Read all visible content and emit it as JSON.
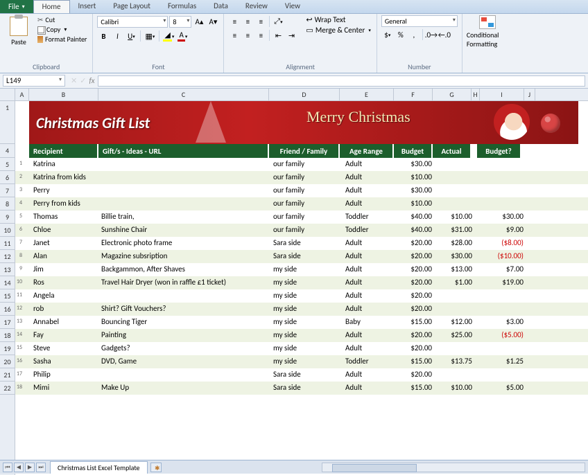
{
  "ribbon": {
    "file": "File",
    "tabs": [
      "Home",
      "Insert",
      "Page Layout",
      "Formulas",
      "Data",
      "Review",
      "View"
    ],
    "active_tab": "Home",
    "clipboard": {
      "title": "Clipboard",
      "paste": "Paste",
      "cut": "Cut",
      "copy": "Copy",
      "format_painter": "Format Painter"
    },
    "font": {
      "title": "Font",
      "name": "Calibri",
      "size": "8"
    },
    "alignment": {
      "title": "Alignment",
      "wrap": "Wrap Text",
      "merge": "Merge & Center"
    },
    "number": {
      "title": "Number",
      "format": "General"
    },
    "cf": "Conditional Formatting"
  },
  "formula_bar": {
    "name_box": "L149",
    "fx": "fx",
    "value": ""
  },
  "columns": [
    "A",
    "B",
    "C",
    "D",
    "E",
    "F",
    "G",
    "H",
    "I",
    "J"
  ],
  "row_headers": [
    "1",
    "4",
    "5",
    "6",
    "7",
    "8",
    "9",
    "10",
    "11",
    "12",
    "13",
    "14",
    "15",
    "16",
    "17",
    "18",
    "19",
    "20",
    "21",
    "22"
  ],
  "banner": {
    "title": "Christmas Gift List",
    "merry": "Merry Christmas"
  },
  "table": {
    "headers": {
      "recipient": "Recipient",
      "gift": "Gift/s - Ideas - URL",
      "ff": "Friend / Family",
      "age": "Age Range",
      "budget": "Budget",
      "actual": "Actual",
      "budget_q": "Budget?"
    },
    "rows": [
      {
        "n": "1",
        "recipient": "Katrina",
        "gift": "",
        "ff": "our family",
        "age": "Adult",
        "budget": "$30.00",
        "actual": "",
        "q": ""
      },
      {
        "n": "2",
        "recipient": "Katrina from kids",
        "gift": "",
        "ff": "our family",
        "age": "Adult",
        "budget": "$10.00",
        "actual": "",
        "q": ""
      },
      {
        "n": "3",
        "recipient": "Perry",
        "gift": "",
        "ff": "our family",
        "age": "Adult",
        "budget": "$30.00",
        "actual": "",
        "q": ""
      },
      {
        "n": "4",
        "recipient": "Perry from kids",
        "gift": "",
        "ff": "our family",
        "age": "Adult",
        "budget": "$10.00",
        "actual": "",
        "q": ""
      },
      {
        "n": "5",
        "recipient": "Thomas",
        "gift": "Billie train,",
        "ff": "our family",
        "age": "Toddler",
        "budget": "$40.00",
        "actual": "$10.00",
        "q": "$30.00"
      },
      {
        "n": "6",
        "recipient": "Chloe",
        "gift": "Sunshine Chair",
        "ff": "our family",
        "age": "Toddler",
        "budget": "$40.00",
        "actual": "$31.00",
        "q": "$9.00"
      },
      {
        "n": "7",
        "recipient": "Janet",
        "gift": "Electronic photo frame",
        "ff": "Sara side",
        "age": "Adult",
        "budget": "$20.00",
        "actual": "$28.00",
        "q": "($8.00)",
        "neg": true
      },
      {
        "n": "8",
        "recipient": "Alan",
        "gift": "Magazine subsription",
        "ff": "Sara side",
        "age": "Adult",
        "budget": "$20.00",
        "actual": "$30.00",
        "q": "($10.00)",
        "neg": true
      },
      {
        "n": "9",
        "recipient": "Jim",
        "gift": "Backgammon, After Shaves",
        "ff": "my side",
        "age": "Adult",
        "budget": "$20.00",
        "actual": "$13.00",
        "q": "$7.00"
      },
      {
        "n": "10",
        "recipient": "Ros",
        "gift": "Travel Hair Dryer (won in raffle £1 ticket)",
        "ff": "my side",
        "age": "Adult",
        "budget": "$20.00",
        "actual": "$1.00",
        "q": "$19.00"
      },
      {
        "n": "11",
        "recipient": "Angela",
        "gift": "",
        "ff": "my side",
        "age": "Adult",
        "budget": "$20.00",
        "actual": "",
        "q": ""
      },
      {
        "n": "12",
        "recipient": "rob",
        "gift": "Shirt? Gift Vouchers?",
        "ff": "my side",
        "age": "Adult",
        "budget": "$20.00",
        "actual": "",
        "q": ""
      },
      {
        "n": "13",
        "recipient": "Annabel",
        "gift": "Bouncing Tiger",
        "ff": "my side",
        "age": "Baby",
        "budget": "$15.00",
        "actual": "$12.00",
        "q": "$3.00"
      },
      {
        "n": "14",
        "recipient": "Fay",
        "gift": "Painting",
        "ff": "my side",
        "age": "Adult",
        "budget": "$20.00",
        "actual": "$25.00",
        "q": "($5.00)",
        "neg": true
      },
      {
        "n": "15",
        "recipient": "Steve",
        "gift": "Gadgets?",
        "ff": "my side",
        "age": "Adult",
        "budget": "$20.00",
        "actual": "",
        "q": ""
      },
      {
        "n": "16",
        "recipient": "Sasha",
        "gift": "DVD, Game",
        "ff": "my side",
        "age": "Toddler",
        "budget": "$15.00",
        "actual": "$13.75",
        "q": "$1.25"
      },
      {
        "n": "17",
        "recipient": "Philip",
        "gift": "",
        "ff": "Sara side",
        "age": "Adult",
        "budget": "$20.00",
        "actual": "",
        "q": ""
      },
      {
        "n": "18",
        "recipient": "Mimi",
        "gift": "Make Up",
        "ff": "Sara side",
        "age": "Adult",
        "budget": "$15.00",
        "actual": "$10.00",
        "q": "$5.00"
      }
    ]
  },
  "sheet_tab": "Christmas List Excel Template"
}
